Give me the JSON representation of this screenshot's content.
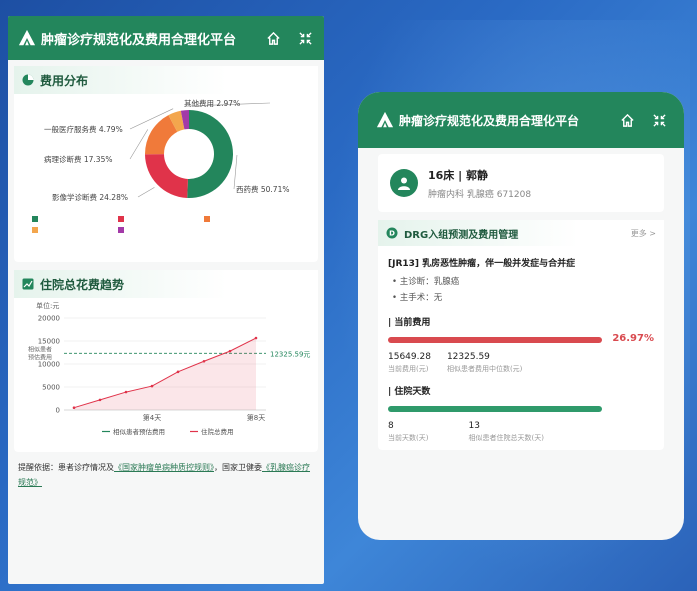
{
  "app": {
    "title": "肿瘤诊疗规范化及费用合理化平台"
  },
  "left": {
    "cost_section": {
      "title": "费用分布"
    },
    "pie": {
      "slices": [
        {
          "name": "西药费",
          "label": "西药费 50.71%",
          "value": 50.71,
          "color": "#23865c"
        },
        {
          "name": "影像学诊断费",
          "label": "影像学诊断费 24.28%",
          "value": 24.28,
          "color": "#e0334a"
        },
        {
          "name": "病理诊断费",
          "label": "病理诊断费 17.35%",
          "value": 17.35,
          "color": "#f07a3a"
        },
        {
          "name": "一般医疗服务费",
          "label": "一般医疗服务费 4.79%",
          "value": 4.79,
          "color": "#f3a64d"
        },
        {
          "name": "其他费用",
          "label": "其他费用 2.97%",
          "value": 2.97,
          "color": "#a33aa8"
        }
      ]
    },
    "legend": [
      "西药费",
      "影像学诊断费",
      "病理诊断费",
      "一般医疗服务费",
      "其他费用"
    ],
    "trend_section": {
      "title": "住院总花费趋势"
    },
    "note": {
      "prefix": "提醒依据：患者诊疗情况及",
      "link1": "《国家肿瘤单病种质控规则》",
      "mid": "，国家卫健委",
      "link2": "《乳腺癌诊疗规范》"
    }
  },
  "chart_data": {
    "type": "line",
    "unit_label": "单位:元",
    "x": [
      1,
      2,
      3,
      4,
      5,
      6,
      7,
      8
    ],
    "xticks": [
      "第4天",
      "第8天"
    ],
    "series": [
      {
        "name": "住院总费用",
        "values": [
          500,
          2200,
          3900,
          5200,
          8300,
          10600,
          12800,
          15649.28
        ],
        "color": "#e0334a"
      }
    ],
    "reference": {
      "name": "相似患者预估费用",
      "value": 12325.59,
      "label": "12325.59元",
      "side_label": "相似患者 预估费用",
      "color": "#23865c"
    },
    "yticks": [
      0,
      5000,
      10000,
      15000,
      20000
    ],
    "ylim": [
      0,
      20000
    ]
  },
  "right": {
    "patient": {
      "name": "16床 | 郭静",
      "info": "肿瘤内科  乳腺癌  671208"
    },
    "drg": {
      "title": "DRG入组预测及费用管理",
      "more": "更多 >",
      "diag": "[JR13] 乳房恶性肿瘤，伴一般并发症与合并症",
      "bullets": [
        "主诊断：乳腺癌",
        "主手术：无"
      ],
      "cost": {
        "title": "当前费用",
        "pct": "26.97%",
        "fill": 1.0,
        "current": "15649.28",
        "current_label": "当前费用(元)",
        "median": "12325.59",
        "median_label": "相似患者费用中位数(元)"
      },
      "days": {
        "title": "住院天数",
        "fill": 1.0,
        "current": "8",
        "current_label": "当前天数(天)",
        "median": "13",
        "median_label": "相似患者住院总天数(天)"
      }
    }
  }
}
